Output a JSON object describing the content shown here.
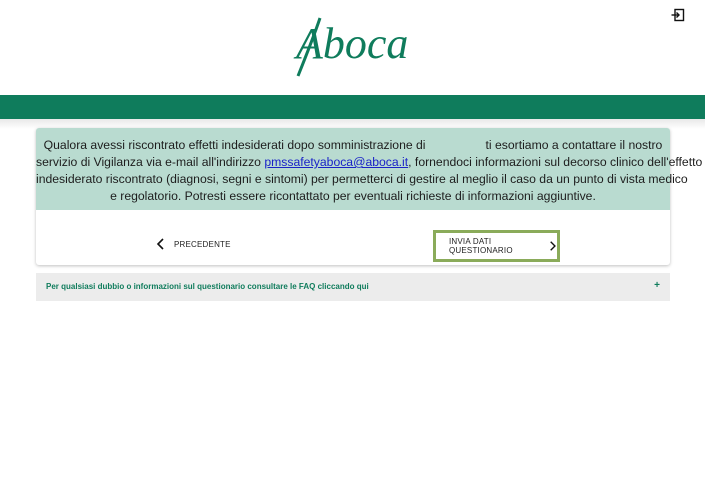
{
  "header": {
    "logo_text": "Aboca",
    "logout_icon": "logout-icon"
  },
  "colors": {
    "brand_green": "#0f7c5c",
    "notice_bg": "#b9dbd0",
    "next_border": "#8aab5a",
    "link": "#1a22c8"
  },
  "notice": {
    "line1_a": "Qualora avessi riscontrato effetti indesiderati dopo somministrazione di",
    "line1_b": "ti esortiamo a contattare il nostro",
    "line2_a": "servizio di Vigilanza via e-mail all'indirizzo",
    "email": "pmssafetyaboca@aboca.it",
    "line2_b": ", fornendoci informazioni sul decorso clinico dell'effetto",
    "line3": "indesiderato riscontrato (diagnosi, segni e sintomi) per permetterci di gestire al meglio il caso da un punto di vista medico",
    "line4": "e regolatorio. Potresti essere ricontattato per eventuali richieste di informazioni aggiuntive."
  },
  "nav": {
    "prev_label": "PRECEDENTE",
    "next_label": "INVIA DATI QUESTIONARIO"
  },
  "faq": {
    "text": "Per qualsiasi dubbio o informazioni sul questionario consultare le FAQ cliccando qui",
    "toggle": "+"
  }
}
